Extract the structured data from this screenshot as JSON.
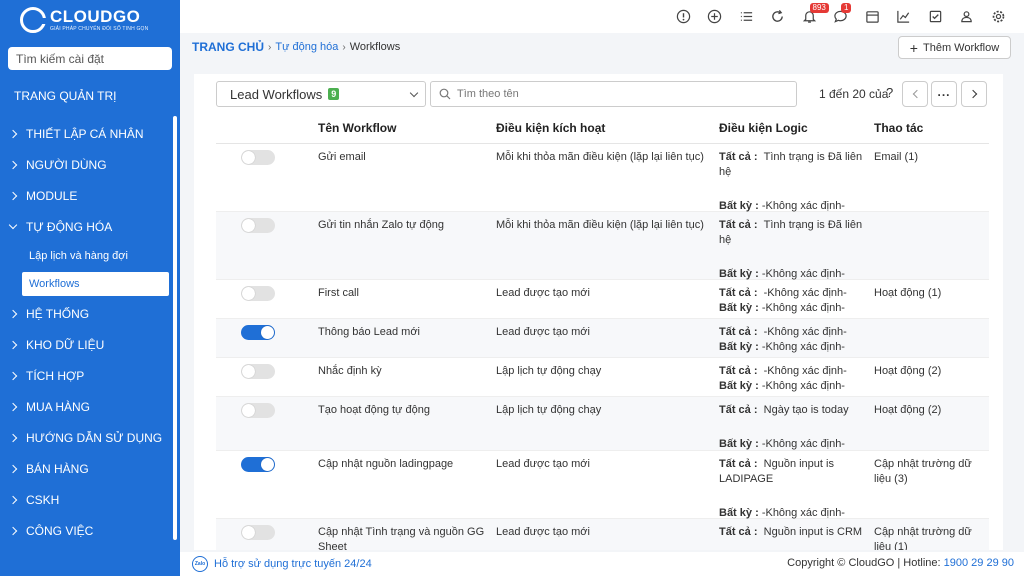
{
  "brand": {
    "name": "CLOUDGO",
    "tagline": "GIẢI PHÁP CHUYỂN ĐỔI SỐ TINH GỌN"
  },
  "sidebar": {
    "search_placeholder": "Tìm kiếm cài đặt",
    "admin_title": "TRANG QUẢN TRỊ",
    "items": [
      {
        "label": "THIẾT LẬP CÁ NHÂN"
      },
      {
        "label": "NGƯỜI DÙNG"
      },
      {
        "label": "MODULE"
      },
      {
        "label": "TỰ ĐỘNG HÓA"
      },
      {
        "label": "HỆ THỐNG"
      },
      {
        "label": "KHO DỮ LIỆU"
      },
      {
        "label": "TÍCH HỢP"
      },
      {
        "label": "MUA HÀNG"
      },
      {
        "label": "HƯỚNG DẪN SỬ DỤNG"
      },
      {
        "label": "BÁN HÀNG"
      },
      {
        "label": "CSKH"
      },
      {
        "label": "CÔNG VIỆC"
      }
    ],
    "sub_items": [
      {
        "label": "Lập lịch và hàng đợi"
      },
      {
        "label": "Workflows"
      }
    ]
  },
  "topbar": {
    "notifications_count": "893",
    "messages_count": "1"
  },
  "breadcrumb": {
    "home": "TRANG CHỦ",
    "section": "Tự động hóa",
    "current": "Workflows"
  },
  "add_button": "Thêm Workflow",
  "filter": {
    "module": "Lead Workflows",
    "count": "9",
    "search_placeholder": "Tìm theo tên",
    "pager": "1 đến 20 của",
    "help": "?"
  },
  "table": {
    "headers": [
      "Tên Workflow",
      "Điều kiện kích hoạt",
      "Điều kiện Logic",
      "Thao tác"
    ],
    "all_label": "Tất cả :",
    "any_label": "Bất kỳ :",
    "rows": [
      {
        "on": false,
        "name": "Gửi email",
        "trigger": "Mỗi khi thỏa mãn điều kiện (lặp lại liên tục)",
        "all": "Tình trạng is Đã liên hệ",
        "any": "-Không xác định-",
        "action": "Email (1)",
        "tall": true
      },
      {
        "on": false,
        "name": "Gửi tin nhắn Zalo tự động",
        "trigger": "Mỗi khi thỏa mãn điều kiện (lặp lại liên tục)",
        "all": "Tình trạng is Đã liên hệ",
        "any": "-Không xác định-",
        "action": "",
        "tall": true
      },
      {
        "on": false,
        "name": "First call",
        "trigger": "Lead được tạo mới",
        "all": "-Không xác định-",
        "any": "-Không xác định-",
        "action": "Hoạt động (1)",
        "tall": false
      },
      {
        "on": true,
        "name": "Thông báo Lead mới",
        "trigger": "Lead được tạo mới",
        "all": "-Không xác định-",
        "any": "-Không xác định-",
        "action": "",
        "tall": false
      },
      {
        "on": false,
        "name": "Nhắc định kỳ",
        "trigger": "Lập lịch tự động chạy",
        "all": "-Không xác định-",
        "any": "-Không xác định-",
        "action": "Hoạt động (2)",
        "tall": false
      },
      {
        "on": false,
        "name": "Tạo hoạt động tự động",
        "trigger": "Lập lịch tự động chạy",
        "all": "Ngày tạo is today",
        "any": "-Không xác định-",
        "action": "Hoạt động (2)",
        "tall": true
      },
      {
        "on": true,
        "name": "Cập nhật nguồn ladingpage",
        "trigger": "Lead được tạo mới",
        "all": "Nguồn input is LADIPAGE",
        "any": "-Không xác định-",
        "action": "Cập nhật trường dữ liệu (3)",
        "tall": true
      },
      {
        "on": false,
        "name": "Cập nhật Tình trạng và nguồn GG Sheet",
        "trigger": "Lead được tạo mới",
        "all": "Nguồn input is CRM",
        "any": "",
        "action": "Cập nhật trường dữ liệu (1)",
        "tall": true
      }
    ]
  },
  "footer": {
    "zalo": "Zalo",
    "support": "Hỗ trợ sử dụng trực tuyến 24/24",
    "copyright": "Copyright © CloudGO | Hotline: ",
    "hotline": "1900 29 29 90"
  }
}
